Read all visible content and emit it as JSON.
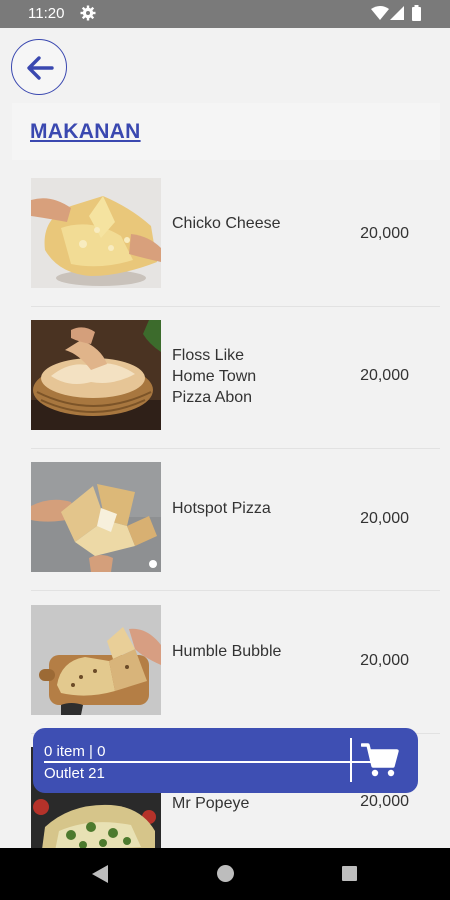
{
  "status_bar": {
    "time": "11:20",
    "icons": [
      "settings-gear-icon",
      "wifi-icon",
      "signal-icon",
      "battery-icon"
    ]
  },
  "header": {
    "back_icon": "arrow-left-icon",
    "section_title": "MAKANAN"
  },
  "menu_items": [
    {
      "name": "Chicko Cheese",
      "price": "20,000"
    },
    {
      "name": "Floss Like Home Town Pizza Abon",
      "price": "20,000"
    },
    {
      "name": "Hotspot Pizza",
      "price": "20,000"
    },
    {
      "name": "Humble Bubble",
      "price": "20,000"
    },
    {
      "name": "Mr Popeye",
      "price": "20,000"
    }
  ],
  "cart": {
    "summary": "0 item | 0",
    "outlet": "Outlet 21",
    "icon": "shopping-cart-icon"
  },
  "nav_bar": {
    "icons": [
      "nav-back-icon",
      "nav-home-icon",
      "nav-recents-icon"
    ]
  },
  "colors": {
    "accent": "#3e4fb3",
    "status_bar": "#7a7a7a",
    "background": "#f2f2f2"
  }
}
